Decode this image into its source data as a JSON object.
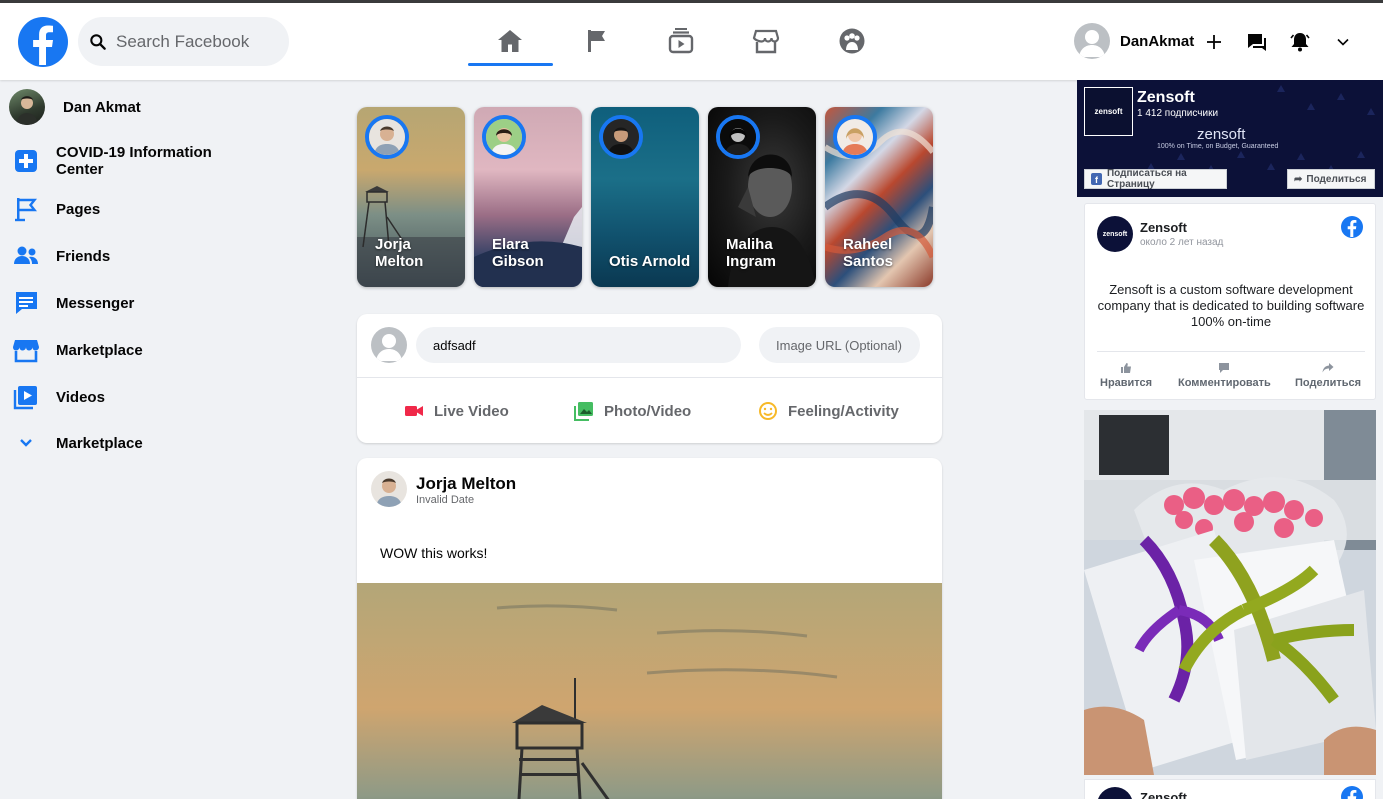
{
  "header": {
    "search_placeholder": "Search Facebook",
    "username": "DanAkmat",
    "nav": [
      "home-icon",
      "flag-icon",
      "watch-icon",
      "marketplace-icon",
      "groups-icon"
    ],
    "accent": "#1877f2"
  },
  "sidebar": {
    "profile_name": "Dan Akmat",
    "items": [
      {
        "label": "COVID-19 Information Center",
        "icon": "plus-square-icon"
      },
      {
        "label": "Pages",
        "icon": "flag-icon"
      },
      {
        "label": "Friends",
        "icon": "friends-icon"
      },
      {
        "label": "Messenger",
        "icon": "messenger-icon"
      },
      {
        "label": "Marketplace",
        "icon": "marketplace-icon"
      },
      {
        "label": "Videos",
        "icon": "video-icon"
      },
      {
        "label": "Marketplace",
        "icon": "chevron-down-icon"
      }
    ]
  },
  "stories": [
    {
      "name": "Jorja Melton"
    },
    {
      "name": "Elara Gibson"
    },
    {
      "name": "Otis Arnold"
    },
    {
      "name": "Maliha Ingram"
    },
    {
      "name": "Raheel Santos"
    }
  ],
  "composer": {
    "input_value": "adfsadf",
    "url_placeholder": "Image URL (Optional)",
    "live_video": "Live Video",
    "photo_video": "Photo/Video",
    "feeling": "Feeling/Activity"
  },
  "post": {
    "author": "Jorja Melton",
    "date": "Invalid Date",
    "text": "WOW this works!"
  },
  "right": {
    "page_name": "Zensoft",
    "subscribers": "1 412 подписчики",
    "brand": "zensoft",
    "tagline": "100% on Time, on Budget, Guaranteed",
    "logo_text": "zensoft",
    "follow_label": "Подписаться на Страницу",
    "share_label": "Поделиться",
    "post_name": "Zensoft",
    "post_time": "около 2 лет назад",
    "post_text": "Zensoft is a custom software development company that is dedicated to building software 100% on-time",
    "like": "Нравится",
    "comment": "Комментировать",
    "share": "Поделиться",
    "post2_name": "Zensoft"
  }
}
